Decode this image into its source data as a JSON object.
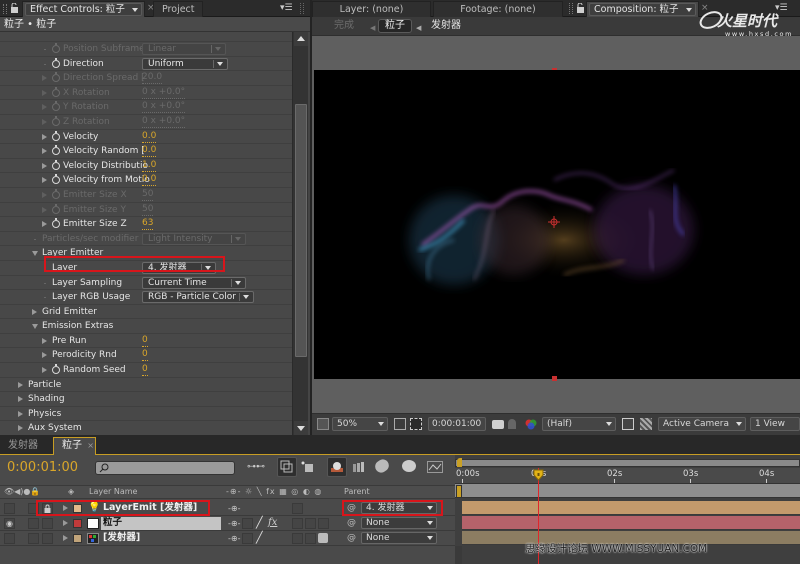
{
  "effect_panel": {
    "tab_label": "Effect Controls: 粒子",
    "project_tab": "Project",
    "breadcrumb": "粒子 • 粒子",
    "rows": [
      {
        "label": "Position Subframe",
        "type": "select",
        "value": "Linear",
        "dim": true,
        "indent": 2,
        "stopwatch": true,
        "twirl": "none"
      },
      {
        "label": "Direction",
        "type": "select",
        "value": "Uniform",
        "dim": false,
        "indent": 2,
        "stopwatch": true,
        "twirl": "none"
      },
      {
        "label": "Direction Spread [",
        "type": "value",
        "value": "20.0",
        "dim": true,
        "indent": 2,
        "stopwatch": true,
        "twirl": "closed"
      },
      {
        "label": "X Rotation",
        "type": "value",
        "value": "0 x +0.0°",
        "dim": true,
        "indent": 2,
        "stopwatch": true,
        "twirl": "closed"
      },
      {
        "label": "Y Rotation",
        "type": "value",
        "value": "0 x +0.0°",
        "dim": true,
        "indent": 2,
        "stopwatch": true,
        "twirl": "closed"
      },
      {
        "label": "Z Rotation",
        "type": "value",
        "value": "0 x +0.0°",
        "dim": true,
        "indent": 2,
        "stopwatch": true,
        "twirl": "closed"
      },
      {
        "label": "Velocity",
        "type": "value",
        "value": "0.0",
        "dim": false,
        "indent": 2,
        "stopwatch": true,
        "twirl": "closed"
      },
      {
        "label": "Velocity Random [",
        "type": "value",
        "value": "0.0",
        "dim": false,
        "indent": 2,
        "stopwatch": true,
        "twirl": "closed"
      },
      {
        "label": "Velocity Distributio",
        "type": "value",
        "value": "1.0",
        "dim": false,
        "indent": 2,
        "stopwatch": true,
        "twirl": "closed"
      },
      {
        "label": "Velocity from Motio",
        "type": "value",
        "value": "0.0",
        "dim": false,
        "indent": 2,
        "stopwatch": true,
        "twirl": "closed"
      },
      {
        "label": "Emitter Size X",
        "type": "value",
        "value": "50",
        "dim": true,
        "indent": 2,
        "stopwatch": true,
        "twirl": "closed"
      },
      {
        "label": "Emitter Size Y",
        "type": "value",
        "value": "50",
        "dim": true,
        "indent": 2,
        "stopwatch": true,
        "twirl": "closed"
      },
      {
        "label": "Emitter Size Z",
        "type": "value",
        "value": "63",
        "dim": false,
        "indent": 2,
        "stopwatch": true,
        "twirl": "closed"
      },
      {
        "label": "Particles/sec modifier",
        "type": "select",
        "value": "Light Intensity",
        "dim": true,
        "indent": 1,
        "stopwatch": false,
        "twirl": "none"
      },
      {
        "label": "Layer Emitter",
        "type": "group",
        "value": "",
        "dim": false,
        "indent": 1,
        "stopwatch": false,
        "twirl": "open"
      },
      {
        "label": "Layer",
        "type": "select",
        "value": "4. 发射器",
        "dim": false,
        "indent": 2,
        "stopwatch": false,
        "twirl": "none",
        "highlight": true
      },
      {
        "label": "Layer Sampling",
        "type": "select",
        "value": "Current Time",
        "dim": false,
        "indent": 2,
        "stopwatch": false,
        "twirl": "none"
      },
      {
        "label": "Layer RGB Usage",
        "type": "select",
        "value": "RGB - Particle Color",
        "dim": false,
        "indent": 2,
        "stopwatch": false,
        "twirl": "none"
      },
      {
        "label": "Grid Emitter",
        "type": "group",
        "value": "",
        "dim": false,
        "indent": 1,
        "stopwatch": false,
        "twirl": "closed"
      },
      {
        "label": "Emission Extras",
        "type": "group",
        "value": "",
        "dim": false,
        "indent": 1,
        "stopwatch": false,
        "twirl": "open"
      },
      {
        "label": "Pre Run",
        "type": "value",
        "value": "0",
        "dim": false,
        "indent": 2,
        "stopwatch": false,
        "twirl": "closed"
      },
      {
        "label": "Perodicity Rnd",
        "type": "value",
        "value": "0",
        "dim": false,
        "indent": 2,
        "stopwatch": false,
        "twirl": "closed"
      },
      {
        "label": "Random Seed",
        "type": "value",
        "value": "0",
        "dim": false,
        "indent": 2,
        "stopwatch": true,
        "twirl": "closed"
      },
      {
        "label": "Particle",
        "type": "group",
        "value": "",
        "dim": false,
        "indent": 0,
        "stopwatch": false,
        "twirl": "closed"
      },
      {
        "label": "Shading",
        "type": "group",
        "value": "",
        "dim": false,
        "indent": 0,
        "stopwatch": false,
        "twirl": "closed"
      },
      {
        "label": "Physics",
        "type": "group",
        "value": "",
        "dim": false,
        "indent": 0,
        "stopwatch": false,
        "twirl": "closed"
      },
      {
        "label": "Aux System",
        "type": "group",
        "value": "",
        "dim": false,
        "indent": 0,
        "stopwatch": false,
        "twirl": "closed"
      }
    ]
  },
  "viewer": {
    "tabs": {
      "layer": "Layer: (none)",
      "footage": "Footage: (none)",
      "composition": "Composition: 粒子"
    },
    "nav": {
      "done": "完成",
      "current": "粒子",
      "next": "发射器"
    },
    "watermark_top": "火星时代",
    "watermark_top_url": "www.hxsd.com",
    "toolbar": {
      "zoom": "50%",
      "timecode": "0:00:01:00",
      "resolution": "(Half)",
      "camera": "Active Camera",
      "views": "1 View"
    }
  },
  "timeline": {
    "tabs": [
      {
        "label": "发射器",
        "active": false
      },
      {
        "label": "粒子",
        "active": true
      }
    ],
    "timecode": "0:00:01:00",
    "search_placeholder": "",
    "columns": {
      "layer_name": "Layer Name",
      "parent": "Parent"
    },
    "ruler": [
      "0:00s",
      "01s",
      "02s",
      "03s",
      "04s"
    ],
    "current_time_fraction": 0.25,
    "layers": [
      {
        "name": "LayerEmit [发射器]",
        "label_color": "#e3b98a",
        "type": "light",
        "visible": false,
        "locked": true,
        "parent": "4. 发射器",
        "bar_color": "#c39a6c",
        "selected": false
      },
      {
        "name": "粒子",
        "label_color": "#c03a3a",
        "type": "solid",
        "visible": true,
        "locked": false,
        "parent": "None",
        "bar_color": "#b5626a",
        "selected": true
      },
      {
        "name": "[发射器]",
        "label_color": "#c1a47a",
        "type": "comp",
        "visible": false,
        "locked": false,
        "parent": "None",
        "bar_color": "#8c7d62",
        "selected": false
      }
    ],
    "watermark_bottom": "思缘设计论坛 WWW.MISSYUAN.COM"
  },
  "colors": {
    "accent_orange": "#d9a62a",
    "highlight_red": "#d8151b",
    "playhead_red": "#e0262a"
  }
}
